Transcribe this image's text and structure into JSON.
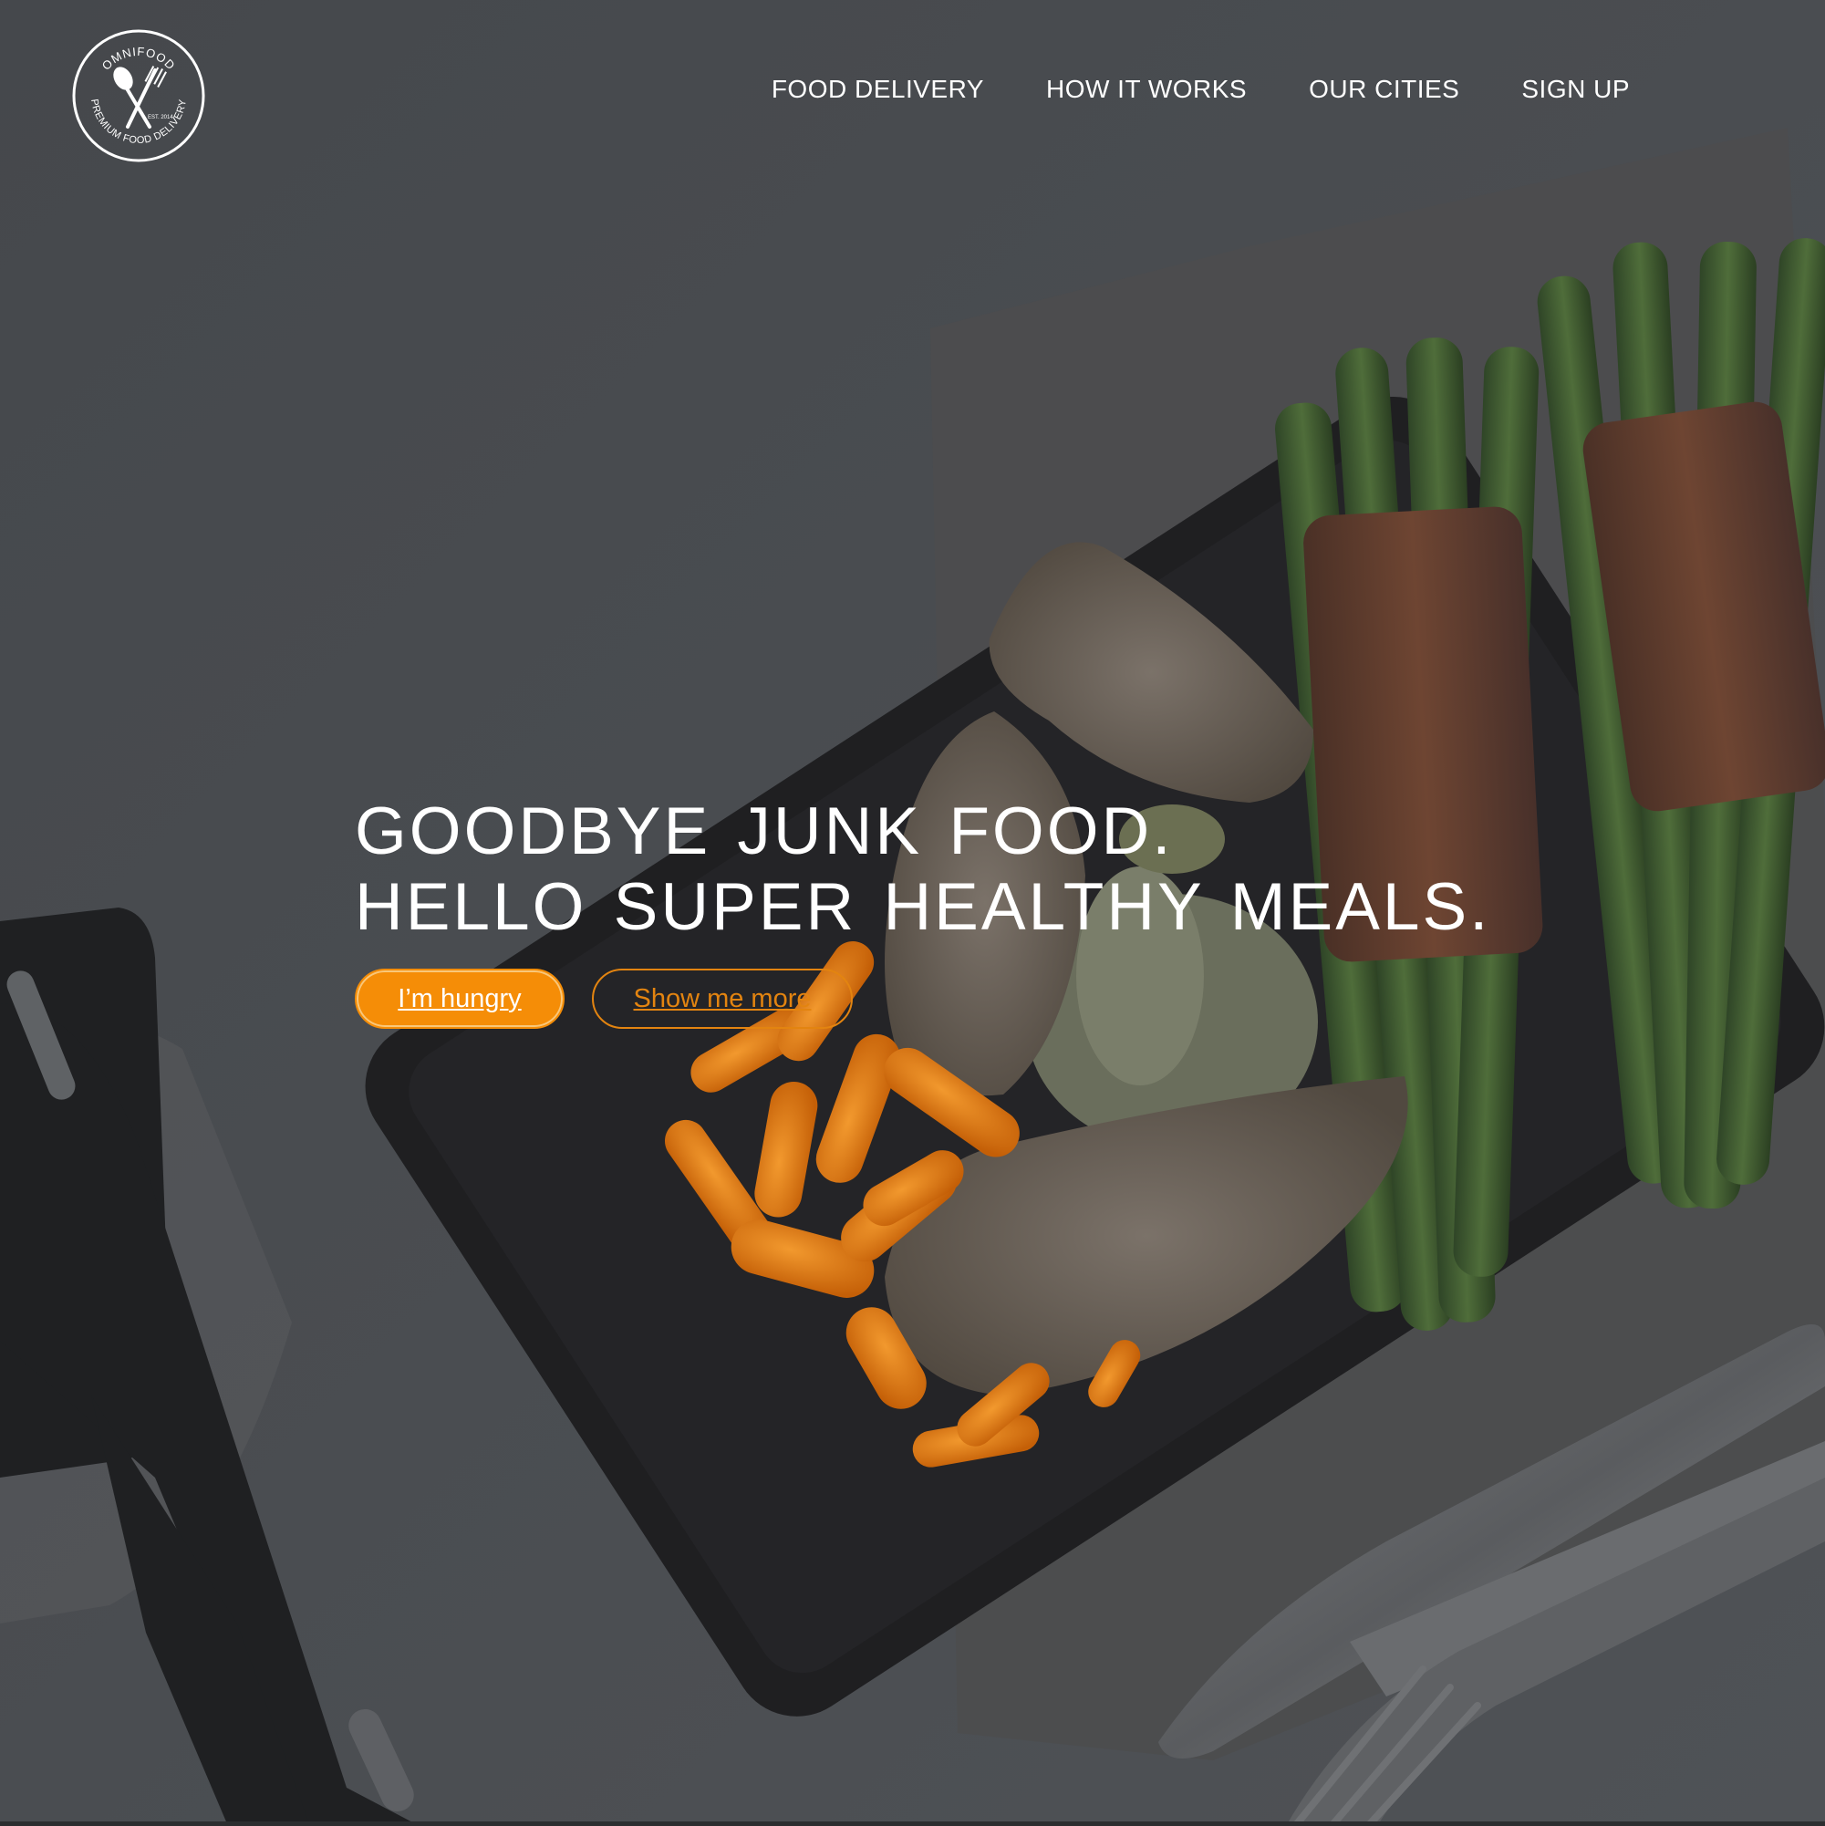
{
  "brand": {
    "name": "OMNIFOOD",
    "tagline": "PREMIUM FOOD DELIVERY",
    "est": "EST. 2014",
    "logo_icon": "spoon-fork-crossed-icon"
  },
  "nav": {
    "items": [
      {
        "label": "FOOD DELIVERY"
      },
      {
        "label": "HOW IT WORKS"
      },
      {
        "label": "OUR CITIES"
      },
      {
        "label": "SIGN UP"
      }
    ]
  },
  "hero": {
    "headline_line1": "GOODBYE JUNK FOOD.",
    "headline_line2": "HELLO SUPER HEALTHY MEALS.",
    "primary_button": "I’m hungry",
    "secondary_button": "Show me more"
  },
  "colors": {
    "accent": "#f58d07",
    "text": "#ffffff",
    "overlay": "#444649"
  }
}
